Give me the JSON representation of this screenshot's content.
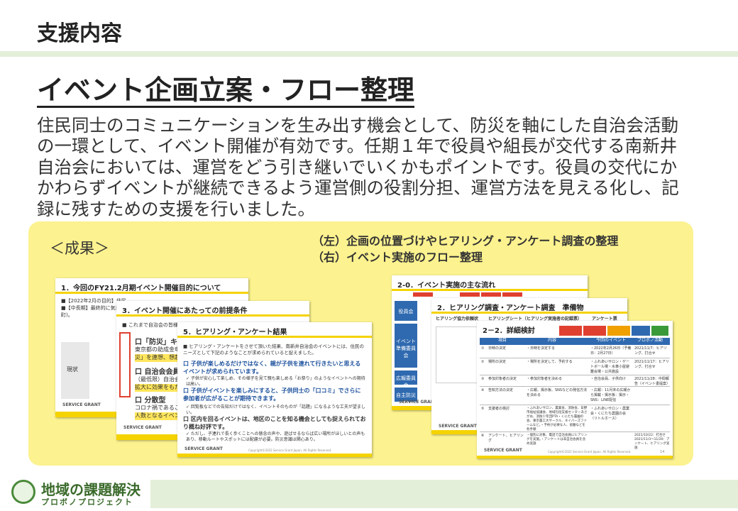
{
  "header": {
    "title": "支援内容"
  },
  "section": {
    "title": "イベント企画立案・フロー整理"
  },
  "body": {
    "text": "住民同士のコミュニケーションを生み出す機会として、防災を軸にした自治会活動の一環として、イベント開催が有効です。任期１年で役員や組長が交代する南新井自治会においては、運営をどう引き継いでいくかもポイントです。役員の交代にかかわらずイベントが継続できるよう運営側の役割分担、運営方法を見える化し、記録に残すための支援を行いました。"
  },
  "results": {
    "label": "＜成果＞",
    "caption_left": "（左）企画の位置づけやヒアリング・アンケート調査の整理",
    "caption_right": "（右）イベント実施のフロー整理"
  },
  "left_slides": {
    "slide1": {
      "title": "1．今回のFY21.2月期イベント開催目的について",
      "line1": "■【2022年2月の目的】住民",
      "line2": "■【中長期】最終的に気楽ん",
      "line3": "町)。",
      "label_now": "現状"
    },
    "slide2": {
      "title": "3．イベント開催にあたっての前提条件",
      "intro": "■ これまで自治会の皆様から",
      "p1": "口「防災」キーワード",
      "p1a": "東京都の助成金申",
      "p1b": "災」を連想、想起で",
      "p2": "口 自治会会員同士",
      "p2a": "（最低限）自治会",
      "p2b": "拡大に効果をもたら",
      "p3": "口 分散型",
      "p3a": "コロナ禍であることか",
      "p3b": "人数となるイベントで"
    },
    "slide3": {
      "title": "5．ヒアリング・アンケート結果",
      "intro": "■ ヒアリング・アンケートをさせて頂いた結果、南新井自治会のイベントには、住民のニーズとして下記のようなことが求められていると捉えました。",
      "b1": "口 子供が楽しめるだけではなく、親が子供を連れて行きたいと思えるイベントが求められています。",
      "b1a": "✓ 子供が安心して楽しめ、その様子を見て親も楽しめる「お祭り」のようなイベントへの期待は高い。",
      "b2": "口 子供がイベントを楽しみにすると、子供同士の「口コミ」でさらに参加者が広がることが期待できます。",
      "b2a": "✓ 回覧板などでの告知だけではなく、イベントそのものが「話題」になるような工夫が望ましい。",
      "b3": "口 区内を回るイベントは、地区のことを知る機会としても捉えられており概ね好評です。",
      "b3a": "✓ ただし、子連れで長く歩くことへの懸念の声や、遊ばせるならば広い場所がほしいとの声もあり、移動ルートやスポットには配慮が必要。防災意識は関心あり。",
      "copyright": "Copyright©2022 Service Grant Japan. All Rights Reserved."
    },
    "logo": "SERVICE GRANT"
  },
  "right_slides": {
    "slide1": {
      "title": "2-0．イベント実施の主な流れ",
      "side1": "役員会",
      "side2": "イベント準備委員会",
      "side3": "広報委員会",
      "side4": "自主防災会"
    },
    "slide2": {
      "title": "2．ヒアリング調査・アンケート調査　準備物",
      "sub1": "ヒアリング協力依頼状",
      "sub2": "ヒアリングシート（ヒアリング実施者の記録票）",
      "sub3": "アンケート票"
    },
    "slide3": {
      "title": "2－2．詳細検討",
      "col1": "項目",
      "col2": "内容",
      "col3": "今回のイベント",
      "col4": "プロボノ活動",
      "rows": [
        {
          "no": "①",
          "item": "日時の決定",
          "content": "・日時を決定する",
          "event": "・2022年2月26日（予備日：2月27日）",
          "pro": "2021/11/7：ヒアリング、打合せ"
        },
        {
          "no": "②",
          "item": "場所の決定",
          "content": "・場所を決定して、予約する",
          "event": "・ふれあいサロン・ゲートボール場・水車小屋避難会場・公共施設",
          "pro": "2021/11/17：ヒアリング、打合せ"
        },
        {
          "no": "③",
          "item": "参加対象者の決定",
          "content": "・参加対象者を決める",
          "event": "・自治会員、子供向け",
          "pro": "2021/11/28：中間報告（イベント書提案）"
        },
        {
          "no": "④",
          "item": "告知方法の決定",
          "content": "・広報、掲示板、SNSなどの発信方法を決める",
          "event": "・広報：11月末の広報から掲載・掲示板：掲示・SNS：LINE配信",
          "pro": ""
        },
        {
          "no": "⑤",
          "item": "支援者の検討",
          "content": "・ふれあいサロン、農業会、消防会、日野市福祉協議会、地域包括支援センターあさがお、消防少年団PTA・くにたち農園の会、東京農工大サークル、ネイバーズファームなど。・予約が必要な人、協働などを各手順",
          "event": "・ふれあいサロン・農業会・くにたち農園の会（リトルホース）",
          "pro": ""
        },
        {
          "no": "⑥",
          "item": "アンケート、ヒアリング",
          "content": "・個別に対象、電話で自治会員にヒアリングを実施。・アンケートは非自治会員を含め実施",
          "event": "",
          "pro": "2021/10/22：打合せ 2021/11/3～11/20：アンケート、ヒアリング実施"
        }
      ],
      "copyright": "Copyright©2022 Service Grant Japan. All Rights Reserved.",
      "page": "14"
    },
    "logo": "SERVICE GRANT"
  },
  "footer": {
    "logo_text": "地域の課題解決",
    "logo_sub": "プロボノプロジェクト"
  },
  "colors": {
    "accent_yellow": "#f5d300",
    "panel_yellow": "#fcf28f",
    "band_green": "#e3efd9",
    "table_blue": "#2f6ab0"
  }
}
